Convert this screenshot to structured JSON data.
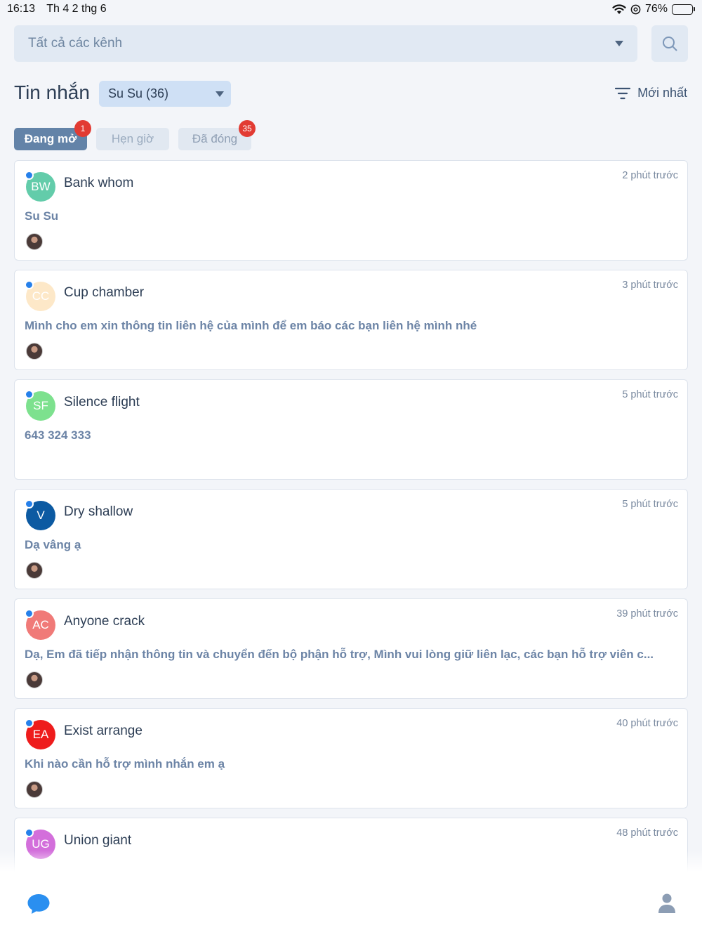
{
  "status_bar": {
    "time": "16:13",
    "date": "Th 4 2 thg 6",
    "battery": "76%",
    "icons": [
      "wifi-icon",
      "at-icon",
      "battery-icon"
    ]
  },
  "channel_select": {
    "value": "Tất cả các kênh"
  },
  "header": {
    "title": "Tin nhắn",
    "agent_select": "Su Su (36)",
    "sort_label": "Mới nhất"
  },
  "tabs": [
    {
      "label": "Đang mở",
      "badge": "1",
      "active": true
    },
    {
      "label": "Hẹn giờ",
      "badge": "",
      "active": false
    },
    {
      "label": "Đã đóng",
      "badge": "35",
      "active": false
    }
  ],
  "conversations": [
    {
      "initials": "BW",
      "color": "#63ccaa",
      "name": "Bank whom",
      "time": "2 phút trước",
      "message": "Su Su",
      "agent": true
    },
    {
      "initials": "CC",
      "color": "#fde8c8",
      "name": "Cup chamber",
      "time": "3 phút trước",
      "message": "Mình cho em xin thông tin liên hệ của mình để em báo các bạn liên hệ mình nhé",
      "agent": true
    },
    {
      "initials": "SF",
      "color": "#7de18e",
      "name": "Silence flight",
      "time": "5 phút trước",
      "message": "643 324 333",
      "agent": false
    },
    {
      "initials": "V",
      "color": "#0c5aa2",
      "name": "Dry shallow",
      "time": "5 phút trước",
      "message": "Dạ vâng ạ",
      "agent": true
    },
    {
      "initials": "AC",
      "color": "#f07a78",
      "name": "Anyone crack",
      "time": "39 phút trước",
      "message": "Dạ, Em đã tiếp nhận thông tin và chuyển đến bộ phận hỗ trợ, Mình vui lòng giữ liên lạc, các bạn hỗ trợ viên c...",
      "agent": true
    },
    {
      "initials": "EA",
      "color": "#ee1c1c",
      "name": "Exist arrange",
      "time": "40 phút trước",
      "message": "Khi nào cần hỗ trợ mình nhắn em ạ",
      "agent": true
    },
    {
      "initials": "UG",
      "color": "#d36fdb",
      "name": "Union giant",
      "time": "48 phút trước",
      "message": "",
      "agent": false
    }
  ],
  "colors": {
    "accent": "#2680ea",
    "badge": "#e23b33",
    "tab_active": "#6383a8"
  }
}
